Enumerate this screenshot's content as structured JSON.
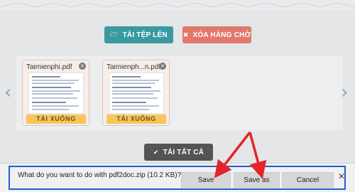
{
  "toolbar": {
    "upload_label": "TẢI TỆP LÊN",
    "clear_label": "XÓA HÀNG CHỜ"
  },
  "queue": {
    "files": [
      {
        "name": "Taimienphi.pdf",
        "download_label": "TẢI XUỐNG"
      },
      {
        "name": "Taimienph...n.pdf",
        "download_label": "TẢI XUỐNG"
      }
    ],
    "prev_icon": "‹",
    "next_icon": "›",
    "download_all_label": "TẢI TẤT CẢ"
  },
  "download_bar": {
    "message": "What do you want to do with pdf2doc.zip (10.2 KB)?",
    "save_label": "Save",
    "save_as_label": "Save as",
    "cancel_label": "Cancel",
    "close_icon": "✕"
  },
  "colors": {
    "upload": "#3a9aa2",
    "clear": "#e2786b",
    "download_all": "#545454",
    "download": "#f6c65b",
    "annotation_arrow": "#e5232b"
  }
}
